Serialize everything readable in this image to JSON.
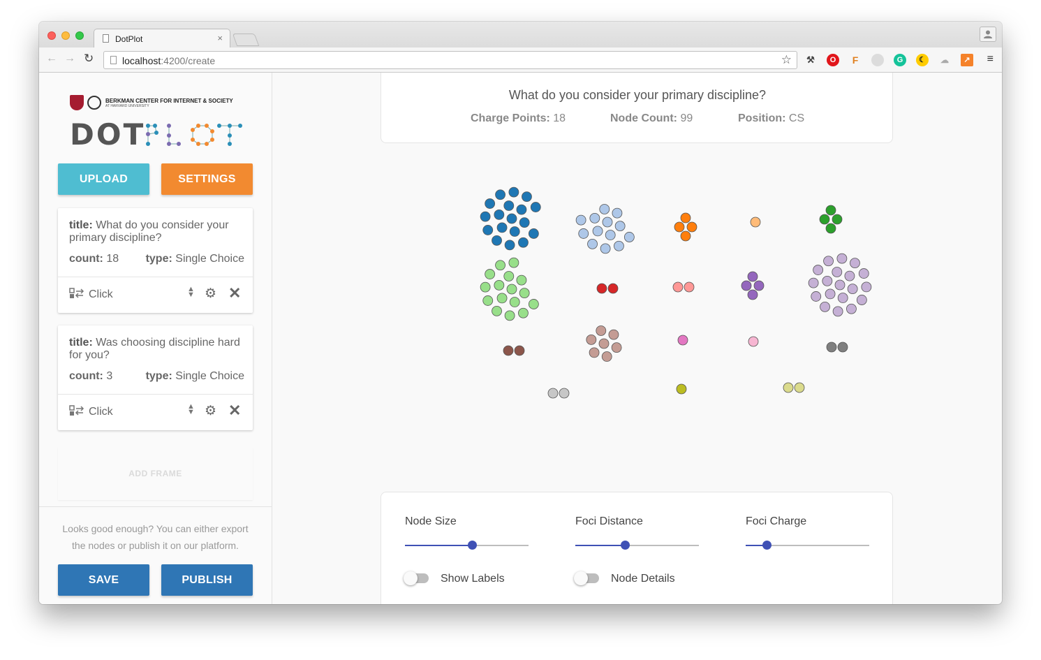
{
  "browser": {
    "tab_title": "DotPlot",
    "tab_close": "×",
    "url_host": "localhost",
    "url_path": ":4200/create",
    "profile_icon": "person-icon",
    "menu_glyph": "≡"
  },
  "sidebar": {
    "org_name": "BERKMAN CENTER FOR INTERNET & SOCIETY",
    "org_sub": "AT HARVARD UNIVERSITY",
    "brand_dot": "DOT",
    "brand_plot": "PLOT",
    "upload_label": "UPLOAD",
    "settings_label": "SETTINGS",
    "frames": [
      {
        "title_key": "title:",
        "title": "What do you consider your primary discipline?",
        "count_key": "count:",
        "count": "18",
        "type_key": "type:",
        "type": "Single Choice",
        "action": "Click"
      },
      {
        "title_key": "title:",
        "title": "Was choosing discipline hard for you?",
        "count_key": "count:",
        "count": "3",
        "type_key": "type:",
        "type": "Single Choice",
        "action": "Click"
      }
    ],
    "add_frame_label": "ADD FRAME",
    "note": "Looks good enough? You can either export the nodes or publish it on our platform.",
    "save_label": "SAVE",
    "publish_label": "PUBLISH"
  },
  "info": {
    "question": "What do you consider your primary discipline?",
    "charge_label": "Charge Points:",
    "charge_value": "18",
    "node_label": "Node Count:",
    "node_value": "99",
    "position_label": "Position:",
    "position_value": "CS"
  },
  "controls": {
    "node_size_label": "Node Size",
    "node_size_value": 0.54,
    "foci_distance_label": "Foci Distance",
    "foci_distance_value": 0.4,
    "foci_charge_label": "Foci Charge",
    "foci_charge_value": 0.17,
    "show_labels_label": "Show Labels",
    "show_labels_on": false,
    "node_details_label": "Node Details",
    "node_details_on": false
  },
  "chart_data": {
    "type": "scatter",
    "clusters": [
      {
        "color": "#1f77b4",
        "count": 18
      },
      {
        "color": "#aec7e8",
        "count": 13
      },
      {
        "color": "#ff7f0e",
        "count": 4
      },
      {
        "color": "#ffbb78",
        "count": 1
      },
      {
        "color": "#2ca02c",
        "count": 4
      },
      {
        "color": "#98df8a",
        "count": 16
      },
      {
        "color": "#d62728",
        "count": 2
      },
      {
        "color": "#ff9896",
        "count": 2
      },
      {
        "color": "#9467bd",
        "count": 4
      },
      {
        "color": "#c5b0d5",
        "count": 19
      },
      {
        "color": "#8c564b",
        "count": 2
      },
      {
        "color": "#c49c94",
        "count": 7
      },
      {
        "color": "#e377c2",
        "count": 1
      },
      {
        "color": "#f7b6d2",
        "count": 1
      },
      {
        "color": "#7f7f7f",
        "count": 2
      },
      {
        "color": "#c7c7c7",
        "count": 2
      },
      {
        "color": "#bcbd22",
        "count": 1
      },
      {
        "color": "#dbdb8d",
        "count": 2
      }
    ]
  }
}
